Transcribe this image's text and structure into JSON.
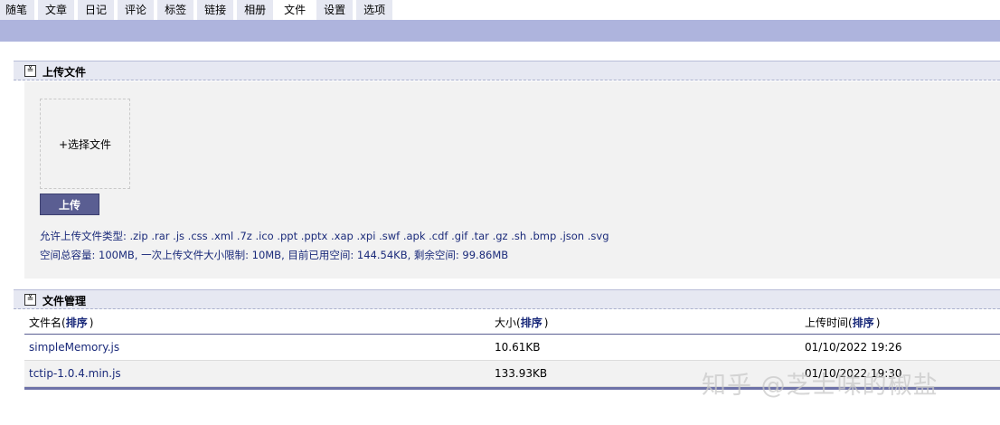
{
  "tabs": [
    {
      "label": "随笔"
    },
    {
      "label": "文章"
    },
    {
      "label": "日记"
    },
    {
      "label": "评论"
    },
    {
      "label": "标签"
    },
    {
      "label": "链接"
    },
    {
      "label": "相册"
    },
    {
      "label": "文件",
      "active": true
    },
    {
      "label": "设置"
    },
    {
      "label": "选项"
    }
  ],
  "upload_section": {
    "toggle": "≚",
    "title": "上传文件",
    "choose_file_label": "+选择文件",
    "upload_button": "上传",
    "allowed_types": "允许上传文件类型: .zip .rar .js .css .xml .7z .ico .ppt .pptx .xap .xpi .swf .apk .cdf .gif .tar .gz .sh .bmp .json .svg",
    "space_info": "空间总容量: 100MB,  一次上传文件大小限制: 10MB,  目前已用空间: 144.54KB,  剩余空间: 99.86MB"
  },
  "manage_section": {
    "toggle": "≚",
    "title": "文件管理",
    "columns": {
      "name": {
        "label": "文件名(",
        "sort": "排序",
        "close": ")"
      },
      "size": {
        "label": "大小(",
        "sort": "排序",
        "close": ")"
      },
      "time": {
        "label": "上传时间(",
        "sort": "排序",
        "close": ")"
      }
    },
    "rows": [
      {
        "name": "simpleMemory.js",
        "size": "10.61KB",
        "time": "01/10/2022 19:26"
      },
      {
        "name": "tctip-1.0.4.min.js",
        "size": "133.93KB",
        "time": "01/10/2022 19:30"
      }
    ]
  },
  "watermark": "知乎 @芝士味的椒盐"
}
